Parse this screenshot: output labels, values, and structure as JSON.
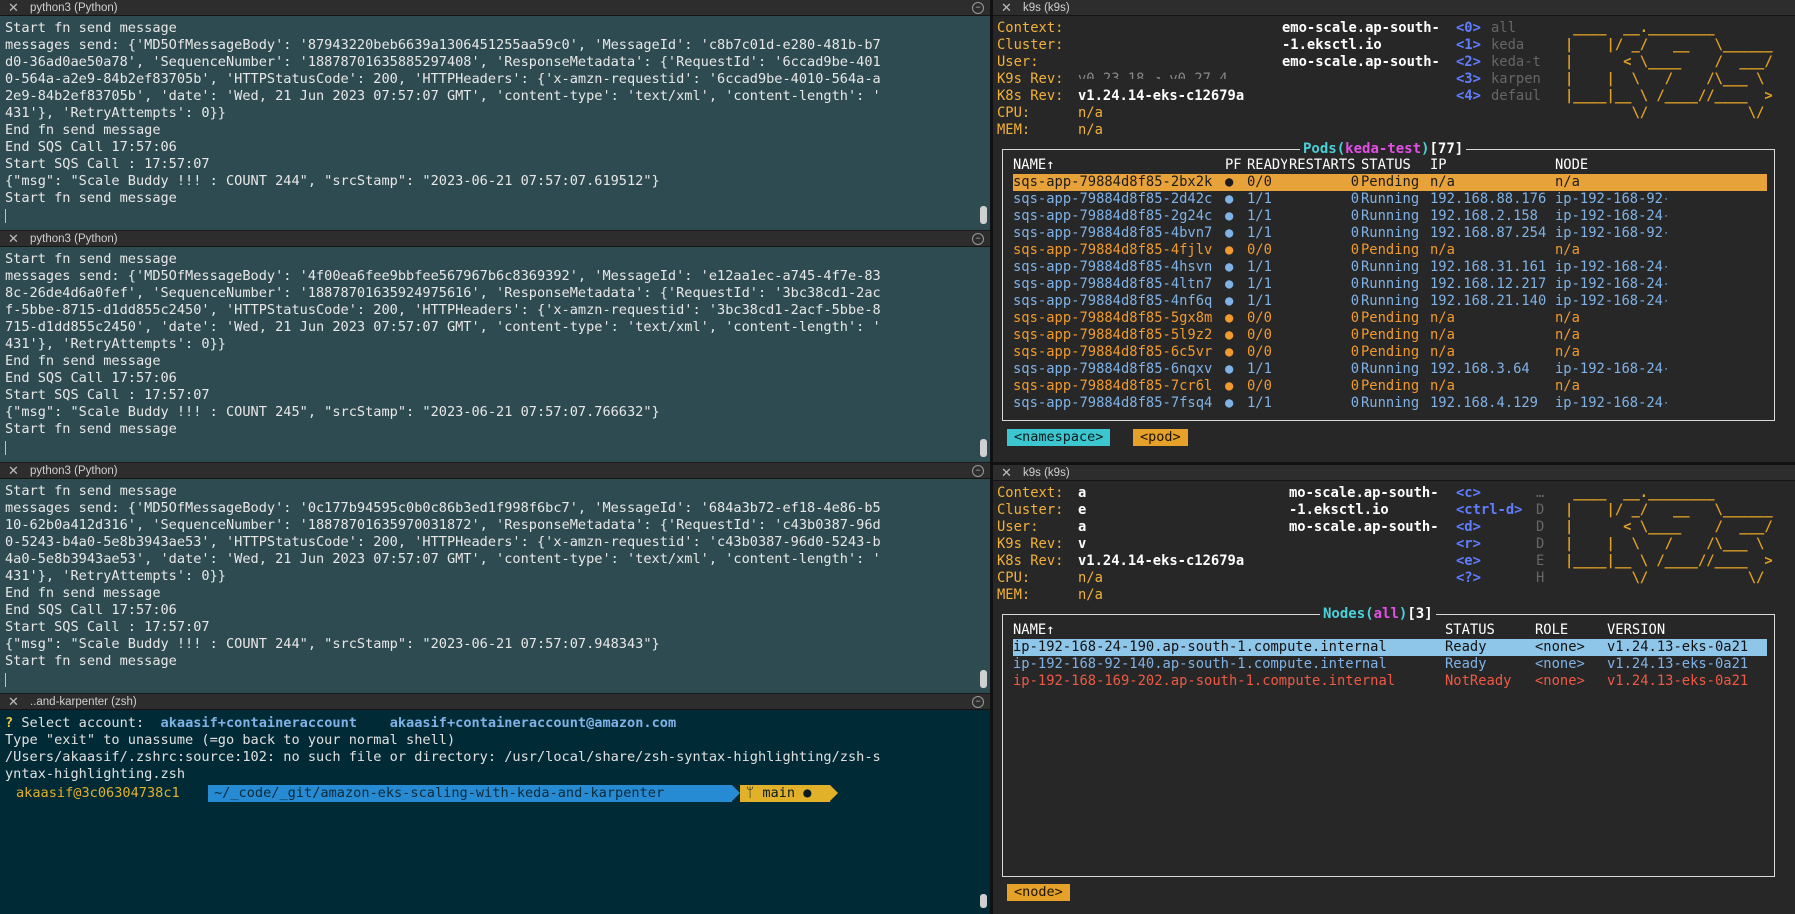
{
  "python_panes": [
    {
      "title": "python3 (Python)",
      "lines": [
        "Start fn send message",
        "messages send: {'MD5OfMessageBody': '87943220beb6639a1306451255aa59c0', 'MessageId': 'c8b7c01d-e280-481b-b7",
        "d0-36ad0ae50a78', 'SequenceNumber': '18878701635885297408', 'ResponseMetadata': {'RequestId': '6ccad9be-401",
        "0-564a-a2e9-84b2ef83705b', 'HTTPStatusCode': 200, 'HTTPHeaders': {'x-amzn-requestid': '6ccad9be-4010-564a-a",
        "2e9-84b2ef83705b', 'date': 'Wed, 21 Jun 2023 07:57:07 GMT', 'content-type': 'text/xml', 'content-length': '",
        "431'}, 'RetryAttempts': 0}}",
        "End fn send message",
        "End SQS Call 17:57:06",
        "Start SQS Call : 17:57:07",
        "{\"msg\": \"Scale Buddy !!! : COUNT 244\", \"srcStamp\": \"2023-06-21 07:57:07.619512\"}",
        "Start fn send message"
      ]
    },
    {
      "title": "python3 (Python)",
      "lines": [
        "Start fn send message",
        "messages send: {'MD5OfMessageBody': '4f00ea6fee9bbfee567967b6c8369392', 'MessageId': 'e12aa1ec-a745-4f7e-83",
        "8c-26de4d6a0fef', 'SequenceNumber': '18878701635924975616', 'ResponseMetadata': {'RequestId': '3bc38cd1-2ac",
        "f-5bbe-8715-d1dd855c2450', 'HTTPStatusCode': 200, 'HTTPHeaders': {'x-amzn-requestid': '3bc38cd1-2acf-5bbe-8",
        "715-d1dd855c2450', 'date': 'Wed, 21 Jun 2023 07:57:07 GMT', 'content-type': 'text/xml', 'content-length': '",
        "431'}, 'RetryAttempts': 0}}",
        "End fn send message",
        "End SQS Call 17:57:06",
        "Start SQS Call : 17:57:07",
        "{\"msg\": \"Scale Buddy !!! : COUNT 245\", \"srcStamp\": \"2023-06-21 07:57:07.766632\"}",
        "Start fn send message"
      ]
    },
    {
      "title": "python3 (Python)",
      "lines": [
        "Start fn send message",
        "messages send: {'MD5OfMessageBody': '0c177b94595c0b0c86b3ed1f998f6bc7', 'MessageId': '684a3b72-ef18-4e86-b5",
        "10-62b0a412d316', 'SequenceNumber': '18878701635970031872', 'ResponseMetadata': {'RequestId': 'c43b0387-96d",
        "0-5243-b4a0-5e8b3943ae53', 'HTTPStatusCode': 200, 'HTTPHeaders': {'x-amzn-requestid': 'c43b0387-96d0-5243-b",
        "4a0-5e8b3943ae53', 'date': 'Wed, 21 Jun 2023 07:57:07 GMT', 'content-type': 'text/xml', 'content-length': '",
        "431'}, 'RetryAttempts': 0}}",
        "End fn send message",
        "End SQS Call 17:57:06",
        "Start SQS Call : 17:57:07",
        "{\"msg\": \"Scale Buddy !!! : COUNT 244\", \"srcStamp\": \"2023-06-21 07:57:07.948343\"}",
        "Start fn send message"
      ]
    }
  ],
  "zsh_pane": {
    "title": "..and-karpenter (zsh)",
    "question_mark": "?",
    "select_label": "Select account:",
    "account_1": "akaasif+containeraccount",
    "account_2": "akaasif+containeraccount@amazon.com",
    "line_2": "Type \"exit\" to unassume (=go back to your normal shell)",
    "line_3": "/Users/akaasif/.zshrc:source:102: no such file or directory: /usr/local/share/zsh-syntax-highlighting/zsh-s",
    "line_4": "yntax-highlighting.zsh",
    "prompt_user": "akaasif@3c06304738c1",
    "prompt_path": "~/_code/_git/amazon-eks-scaling-with-keda-and-karpenter",
    "prompt_branch": "ᛘ main ●"
  },
  "k9s_pods": {
    "title": "k9s (k9s)",
    "header": {
      "context_label": "Context:",
      "context_val": "emo-scale.ap-south-",
      "cluster_label": "Cluster:",
      "cluster_val": "-1.eksctl.io",
      "user_label": "User:",
      "user_val": "emo-scale.ap-south-",
      "k9srev_label": "K9s Rev:",
      "k9srev_val": "v0.23.18 ↗ v0.27.4",
      "k8srev_label": "K8s Rev:",
      "k8srev_val": "v1.24.14-eks-c12679a",
      "cpu_label": "CPU:",
      "cpu_val": "n/a",
      "mem_label": "MEM:",
      "mem_val": "n/a"
    },
    "shortcuts": [
      {
        "key": "<0>",
        "text": "all"
      },
      {
        "key": "<1>",
        "text": "keda"
      },
      {
        "key": "<2>",
        "text": "keda-t"
      },
      {
        "key": "<3>",
        "text": "karpen"
      },
      {
        "key": "<4>",
        "text": "defaul"
      }
    ],
    "logo": [
      " ____  __.________ ",
      "|    |/ _/   __   \\______",
      "|      < \\____    /  ___/",
      "|    |  \\   /    /\\___ \\ ",
      "|____|__ \\ /____//____  >",
      "        \\/            \\/ "
    ],
    "table_title": {
      "resource": "Pods",
      "ns": "keda-test",
      "count": "77"
    },
    "columns": [
      "NAME↑",
      "PF",
      "READY",
      "RESTARTS",
      "STATUS",
      "IP",
      "NODE"
    ],
    "rows": [
      {
        "name": "sqs-app-79884d8f85-2bx2k",
        "pf": "●",
        "ready": "0/0",
        "restarts": "0",
        "status": "Pending",
        "ip": "n/a",
        "node": "n/a",
        "state": "selected"
      },
      {
        "name": "sqs-app-79884d8f85-2d42c",
        "pf": "●",
        "ready": "1/1",
        "restarts": "0",
        "status": "Running",
        "ip": "192.168.88.176",
        "node": "ip-192-168-92-",
        "state": "running"
      },
      {
        "name": "sqs-app-79884d8f85-2g24c",
        "pf": "●",
        "ready": "1/1",
        "restarts": "0",
        "status": "Running",
        "ip": "192.168.2.158",
        "node": "ip-192-168-24-",
        "state": "running"
      },
      {
        "name": "sqs-app-79884d8f85-4bvn7",
        "pf": "●",
        "ready": "1/1",
        "restarts": "0",
        "status": "Running",
        "ip": "192.168.87.254",
        "node": "ip-192-168-92-",
        "state": "running"
      },
      {
        "name": "sqs-app-79884d8f85-4fjlv",
        "pf": "●",
        "ready": "0/0",
        "restarts": "0",
        "status": "Pending",
        "ip": "n/a",
        "node": "n/a",
        "state": "pending"
      },
      {
        "name": "sqs-app-79884d8f85-4hsvn",
        "pf": "●",
        "ready": "1/1",
        "restarts": "0",
        "status": "Running",
        "ip": "192.168.31.161",
        "node": "ip-192-168-24-",
        "state": "running"
      },
      {
        "name": "sqs-app-79884d8f85-4ltn7",
        "pf": "●",
        "ready": "1/1",
        "restarts": "0",
        "status": "Running",
        "ip": "192.168.12.217",
        "node": "ip-192-168-24-",
        "state": "running"
      },
      {
        "name": "sqs-app-79884d8f85-4nf6q",
        "pf": "●",
        "ready": "1/1",
        "restarts": "0",
        "status": "Running",
        "ip": "192.168.21.140",
        "node": "ip-192-168-24-",
        "state": "running"
      },
      {
        "name": "sqs-app-79884d8f85-5gx8m",
        "pf": "●",
        "ready": "0/0",
        "restarts": "0",
        "status": "Pending",
        "ip": "n/a",
        "node": "n/a",
        "state": "pending"
      },
      {
        "name": "sqs-app-79884d8f85-5l9z2",
        "pf": "●",
        "ready": "0/0",
        "restarts": "0",
        "status": "Pending",
        "ip": "n/a",
        "node": "n/a",
        "state": "pending"
      },
      {
        "name": "sqs-app-79884d8f85-6c5vr",
        "pf": "●",
        "ready": "0/0",
        "restarts": "0",
        "status": "Pending",
        "ip": "n/a",
        "node": "n/a",
        "state": "pending"
      },
      {
        "name": "sqs-app-79884d8f85-6nqxv",
        "pf": "●",
        "ready": "1/1",
        "restarts": "0",
        "status": "Running",
        "ip": "192.168.3.64",
        "node": "ip-192-168-24-",
        "state": "running"
      },
      {
        "name": "sqs-app-79884d8f85-7cr6l",
        "pf": "●",
        "ready": "0/0",
        "restarts": "0",
        "status": "Pending",
        "ip": "n/a",
        "node": "n/a",
        "state": "pending"
      },
      {
        "name": "sqs-app-79884d8f85-7fsq4",
        "pf": "●",
        "ready": "1/1",
        "restarts": "0",
        "status": "Running",
        "ip": "192.168.4.129",
        "node": "ip-192-168-24-",
        "state": "running"
      }
    ],
    "crumbs": [
      "<namespace>",
      "<pod>"
    ]
  },
  "k9s_nodes": {
    "title": "k9s (k9s)",
    "header": {
      "context_label": "Context:",
      "context_val": "a",
      "context_val2": "mo-scale.ap-south-",
      "cluster_label": "Cluster:",
      "cluster_val": "e",
      "cluster_val2": "-1.eksctl.io",
      "user_label": "User:",
      "user_val": "a",
      "user_val2": "mo-scale.ap-south-",
      "k9srev_label": "K9s Rev:",
      "k9srev_val": "v",
      "k8srev_label": "K8s Rev:",
      "k8srev_val": "v1.24.14-eks-c12679a",
      "cpu_label": "CPU:",
      "cpu_val": "n/a",
      "mem_label": "MEM:",
      "mem_val": "n/a"
    },
    "shortcuts": [
      {
        "key": "<c>",
        "text": "…"
      },
      {
        "key": "<ctrl-d>",
        "text": "D"
      },
      {
        "key": "<d>",
        "text": "D"
      },
      {
        "key": "<r>",
        "text": "D"
      },
      {
        "key": "<e>",
        "text": "E"
      },
      {
        "key": "<?>",
        "text": "H"
      }
    ],
    "logo": [
      " ____  __.________ ",
      "|    |/ _/   __   \\______",
      "|      < \\____    /  ___/",
      "|    |  \\   /    /\\___ \\ ",
      "|____|__ \\ /____//____  >",
      "        \\/            \\/ "
    ],
    "table_title": {
      "resource": "Nodes",
      "ns": "all",
      "count": "3"
    },
    "columns": [
      "NAME↑",
      "STATUS",
      "ROLE",
      "VERSION"
    ],
    "rows": [
      {
        "name": "ip-192-168-24-190.ap-south-1.compute.internal",
        "status": "Ready",
        "role": "<none>",
        "version": "v1.24.13-eks-0a21",
        "state": "selected"
      },
      {
        "name": "ip-192-168-92-140.ap-south-1.compute.internal",
        "status": "Ready",
        "role": "<none>",
        "version": "v1.24.13-eks-0a21",
        "state": "ready"
      },
      {
        "name": "ip-192-168-169-202.ap-south-1.compute.internal",
        "status": "NotReady",
        "role": "<none>",
        "version": "v1.24.13-eks-0a21",
        "state": "bad"
      }
    ],
    "crumbs": [
      "<node>"
    ]
  }
}
